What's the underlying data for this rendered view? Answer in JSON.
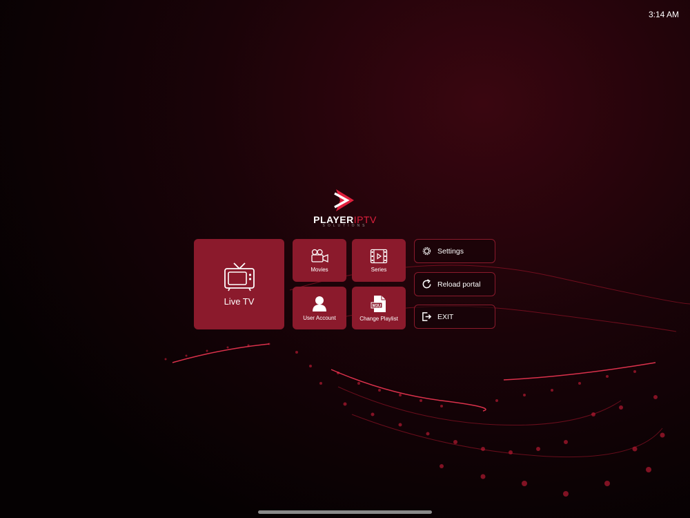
{
  "status_bar": {
    "time": "3:14 AM"
  },
  "logo": {
    "brand_part1": "PLAYER",
    "brand_part2": "IPTV",
    "tagline": "SOLUTIONS"
  },
  "tiles": {
    "live_tv": "Live TV",
    "movies": "Movies",
    "series": "Series",
    "user_account": "User Account",
    "change_playlist": "Change Playlist",
    "m3u_badge": "M3U"
  },
  "side_buttons": {
    "settings": "Settings",
    "reload": "Reload portal",
    "exit": "EXIT"
  },
  "colors": {
    "tile": "#8b1a2c",
    "accent": "#e0203d",
    "background": "#0b0204"
  }
}
